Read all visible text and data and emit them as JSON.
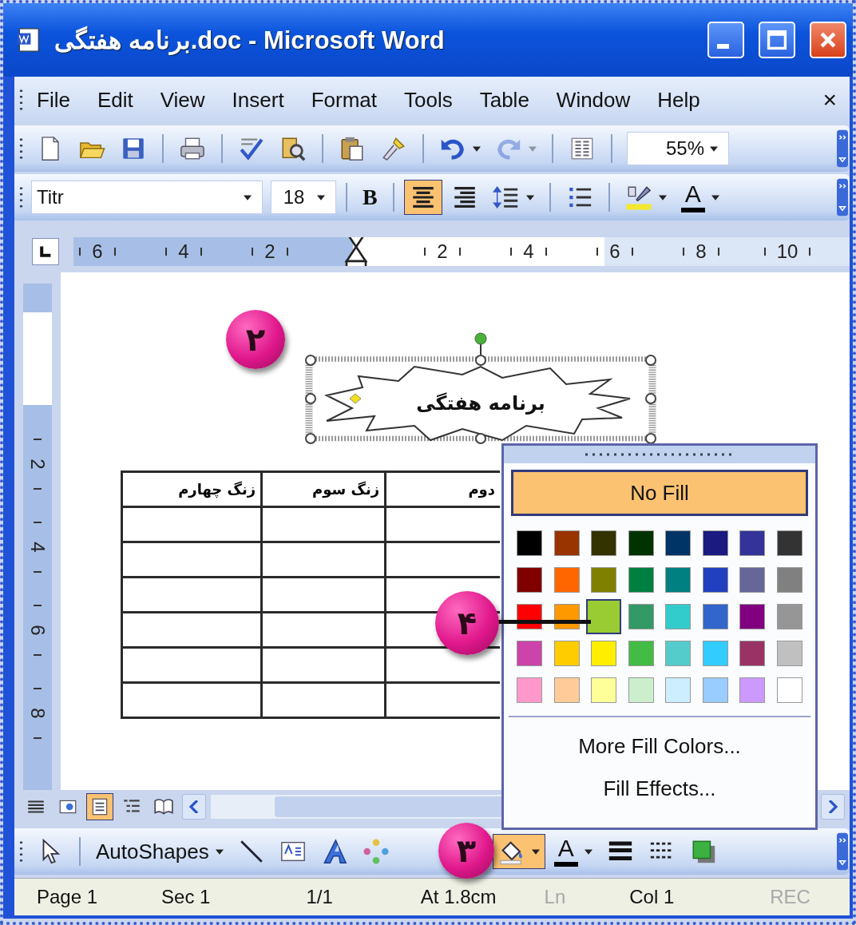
{
  "window": {
    "title": "برنامه هفتگی.doc - Microsoft Word"
  },
  "menu_bar": {
    "items": [
      "File",
      "Edit",
      "View",
      "Insert",
      "Format",
      "Tools",
      "Table",
      "Window",
      "Help"
    ],
    "close": "×"
  },
  "standard_toolbar": {
    "buttons": [
      {
        "kind": "new",
        "disabled": false
      },
      {
        "kind": "open",
        "disabled": false
      },
      {
        "kind": "save",
        "disabled": false
      },
      {
        "kind": "print",
        "disabled": false
      },
      {
        "kind": "spelling",
        "disabled": false
      },
      {
        "kind": "research",
        "disabled": false
      },
      {
        "kind": "paste",
        "disabled": false
      },
      {
        "kind": "painter",
        "disabled": false
      },
      {
        "kind": "undo",
        "disabled": false
      },
      {
        "kind": "redo",
        "disabled": true
      },
      {
        "kind": "columns",
        "disabled": false
      }
    ],
    "zoom": "55%"
  },
  "formatting_toolbar": {
    "font": "Titr",
    "size": "18",
    "buttons": [
      {
        "kind": "bold",
        "label": "B",
        "selected": false
      },
      {
        "kind": "align-center",
        "selected": true
      },
      {
        "kind": "align-right",
        "selected": false
      },
      {
        "kind": "line-spacing",
        "selected": false
      },
      {
        "kind": "bullets",
        "selected": false
      },
      {
        "kind": "highlight",
        "selected": false
      },
      {
        "kind": "font-color",
        "label": "A",
        "selected": false
      }
    ]
  },
  "ruler": {
    "numbers": [
      "6",
      "4",
      "2",
      "2",
      "4",
      "6",
      "8",
      "10"
    ]
  },
  "vertical_ruler": {
    "numbers": [
      "2",
      "4",
      "6",
      "8"
    ]
  },
  "document": {
    "shape_text": "برنامه هفتگی",
    "table": {
      "columns": [
        "دوم",
        "زنگ سوم",
        "زنگ چهارم"
      ]
    }
  },
  "callouts": [
    "۲",
    "۴",
    "۳"
  ],
  "fill_menu": {
    "no_fill": "No Fill",
    "swatches": [
      {
        "color": "#000000",
        "selected": false
      },
      {
        "color": "#993300",
        "selected": false
      },
      {
        "color": "#333300",
        "selected": false
      },
      {
        "color": "#003300",
        "selected": false
      },
      {
        "color": "#003366",
        "selected": false
      },
      {
        "color": "#1a1a80",
        "selected": false
      },
      {
        "color": "#333399",
        "selected": false
      },
      {
        "color": "#333333",
        "selected": false
      },
      {
        "color": "#800000",
        "selected": false
      },
      {
        "color": "#ff6600",
        "selected": false
      },
      {
        "color": "#808000",
        "selected": false
      },
      {
        "color": "#008040",
        "selected": false
      },
      {
        "color": "#008080",
        "selected": false
      },
      {
        "color": "#2040c0",
        "selected": false
      },
      {
        "color": "#666699",
        "selected": false
      },
      {
        "color": "#808080",
        "selected": false
      },
      {
        "color": "#ff0000",
        "selected": false
      },
      {
        "color": "#ff9900",
        "selected": false
      },
      {
        "color": "#99cc33",
        "selected": true
      },
      {
        "color": "#339966",
        "selected": false
      },
      {
        "color": "#33cccc",
        "selected": false
      },
      {
        "color": "#3366cc",
        "selected": false
      },
      {
        "color": "#800080",
        "selected": false
      },
      {
        "color": "#969696",
        "selected": false
      },
      {
        "color": "#cc44aa",
        "selected": false
      },
      {
        "color": "#ffcc00",
        "selected": false
      },
      {
        "color": "#ffee00",
        "selected": false
      },
      {
        "color": "#44bb44",
        "selected": false
      },
      {
        "color": "#55cccc",
        "selected": false
      },
      {
        "color": "#33ccff",
        "selected": false
      },
      {
        "color": "#993366",
        "selected": false
      },
      {
        "color": "#c0c0c0",
        "selected": false
      },
      {
        "color": "#ff99cc",
        "selected": false
      },
      {
        "color": "#ffcc99",
        "selected": false
      },
      {
        "color": "#ffff99",
        "selected": false
      },
      {
        "color": "#cceecc",
        "selected": false
      },
      {
        "color": "#cceeff",
        "selected": false
      },
      {
        "color": "#99ccff",
        "selected": false
      },
      {
        "color": "#cc99ff",
        "selected": false
      },
      {
        "color": "#ffffff",
        "selected": false
      }
    ],
    "more_colors": "More Fill Colors...",
    "fill_effects": "Fill Effects..."
  },
  "view_buttons": [
    {
      "kind": "normal",
      "selected": false
    },
    {
      "kind": "web",
      "selected": false
    },
    {
      "kind": "print",
      "selected": true
    },
    {
      "kind": "outline",
      "selected": false
    },
    {
      "kind": "reading",
      "selected": false
    }
  ],
  "drawing_toolbar": {
    "buttons": [
      {
        "kind": "select",
        "selected": false
      },
      {
        "kind": "autoshapes",
        "label": "AutoShapes",
        "selected": false
      },
      {
        "kind": "line",
        "selected": false
      },
      {
        "kind": "textbox",
        "selected": false
      },
      {
        "kind": "wordart",
        "selected": false
      },
      {
        "kind": "diagram",
        "selected": false
      },
      {
        "kind": "fill",
        "selected": true
      },
      {
        "kind": "font-color",
        "label": "A",
        "selected": false
      },
      {
        "kind": "line-style",
        "selected": false
      },
      {
        "kind": "dash-style",
        "selected": false
      },
      {
        "kind": "shadow",
        "selected": false
      }
    ]
  },
  "status_bar": [
    {
      "text": "Page 1",
      "dimmed": false
    },
    {
      "text": "Sec 1",
      "dimmed": false
    },
    {
      "text": "1/1",
      "dimmed": false
    },
    {
      "text": "At 1.8cm",
      "dimmed": false
    },
    {
      "text": "Ln",
      "dimmed": true
    },
    {
      "text": "Col 1",
      "dimmed": false
    },
    {
      "text": "REC",
      "dimmed": true
    }
  ]
}
